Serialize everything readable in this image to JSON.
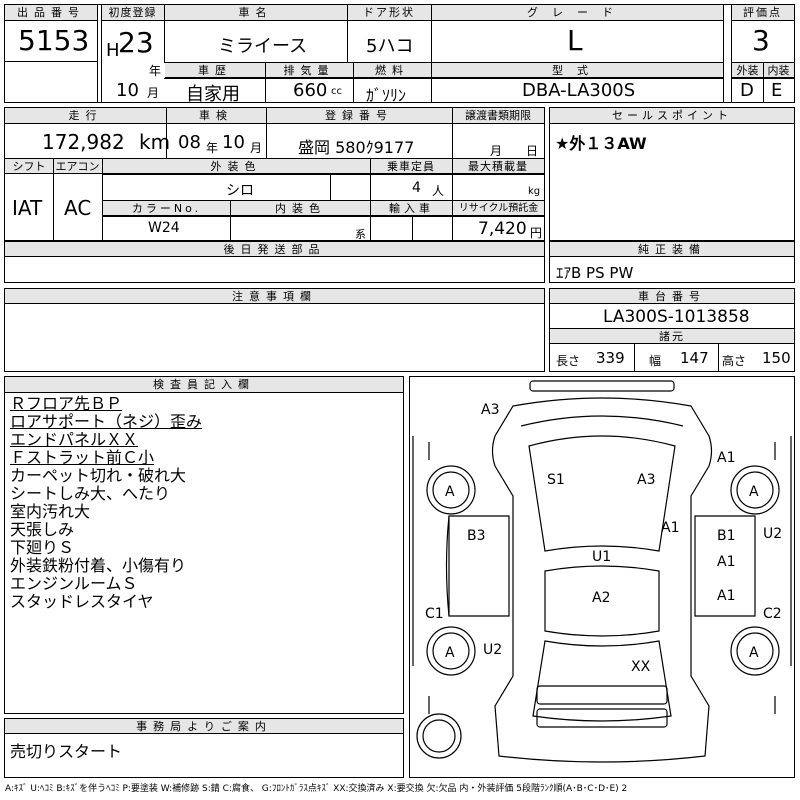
{
  "headers": {
    "lot_no": "出品番号",
    "first_reg": "初度登録",
    "car_name": "車名",
    "door": "ドア形状",
    "grade": "グレード",
    "score": "評価点",
    "history": "車歴",
    "displacement": "排気量",
    "fuel": "燃料",
    "model_code": "型式",
    "exterior": "外装",
    "interior": "内装",
    "mileage": "走行",
    "inspection": "車検",
    "reg_no": "登録番号",
    "transfer": "譲渡書類期限",
    "sales_point": "セールスポイント",
    "shift": "シフト",
    "aircon": "エアコン",
    "ext_color": "外装色",
    "capacity": "乗車定員",
    "max_load": "最大積載量",
    "color_no": "カラーNo.",
    "int_color": "内装色",
    "import": "輸入車",
    "recycle": "リサイクル預託金",
    "later_parts": "後日発送部品",
    "genuine": "純正装備",
    "caution": "注意事項欄",
    "chassis": "車台番号",
    "specs": "諸元",
    "inspector": "検査員記入欄",
    "office": "事務局よりご案内"
  },
  "vehicle": {
    "lot_no": "5153",
    "era": "H",
    "year": "23",
    "year_unit": "年",
    "month": "10",
    "month_unit": "月",
    "name": "ミライース",
    "door": "5ハコ",
    "grade": "L",
    "score": "3",
    "history": "自家用",
    "displacement": "660",
    "cc": "cc",
    "fuel": "ｶﾞｿﾘﾝ",
    "model_code": "DBA-LA300S",
    "exterior": "D",
    "interior": "E",
    "mileage": "172,982",
    "km": "km",
    "insp_year": "08",
    "insp_year_unit": "年",
    "insp_month": "10",
    "insp_month_unit": "月",
    "reg_no": "盛岡 580ｸ9177",
    "transfer_month": "月",
    "transfer_day": "日",
    "sales_point": "★外１３AW",
    "shift": "IAT",
    "aircon": "AC",
    "ext_color": "シロ",
    "capacity": "4",
    "capacity_unit": "人",
    "kg": "kg",
    "color_no": "W24",
    "int_color_suffix": "系",
    "recycle": "7,420",
    "yen": "円",
    "genuine": "ｴｱB PS PW",
    "chassis": "LA300S-1013858",
    "length_label": "長さ",
    "length": "339",
    "width_label": "幅",
    "width": "147",
    "height_label": "高さ",
    "height": "150"
  },
  "inspector_notes": [
    "Ｒフロア先ＢＰ",
    "ロアサポート（ネジ）歪み",
    "エンドパネルＸＸ",
    "Ｆストラット前Ｃ小",
    "カーペット切れ・破れ大",
    "シートしみ大、へたり",
    "室内汚れ大",
    "天張しみ",
    "下廻りＳ",
    "外装鉄粉付着、小傷有り",
    "エンジンルームＳ",
    "スタッドレスタイヤ"
  ],
  "diagram_marks": [
    "A3",
    "A1",
    "S1",
    "A3",
    "A",
    "A",
    "B3",
    "A1",
    "B1",
    "U2",
    "U1",
    "A1",
    "A2",
    "A1",
    "C1",
    "C2",
    "U2",
    "A",
    "A",
    "XX"
  ],
  "office_note": "売切りスタート",
  "legend": "A:ｷｽﾞ U:ﾍｺﾐ B:ｷｽﾞを伴うﾍｺﾐ P:要塗装 W:補修跡 S:錆 C:腐食、 G:ﾌﾛﾝﾄｶﾞﾗｽ点ｷｽﾞ XX:交換済み X:要交換 欠:欠品 内・外装評価 5段階ﾗﾝｸ順(A･B･C･D･E) 2"
}
